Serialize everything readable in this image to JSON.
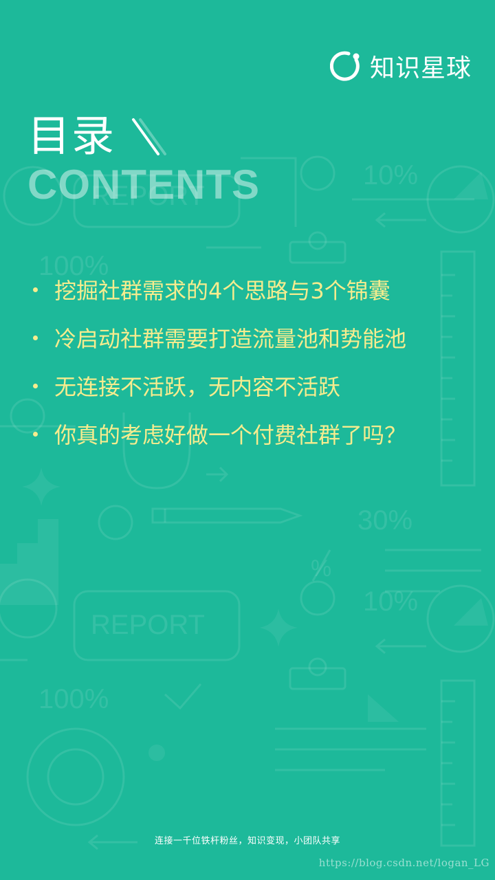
{
  "brand": {
    "name": "知识星球",
    "logo_icon": "ring-with-dot-icon"
  },
  "heading": {
    "title": "目录",
    "subtitle": "CONTENTS"
  },
  "toc": {
    "items": [
      "挖掘社群需求的4个思路与3个锦囊",
      "冷启动社群需要打造流量池和势能池",
      "无连接不活跃，无内容不活跃",
      "你真的考虑好做一个付费社群了吗？"
    ]
  },
  "background_labels": {
    "report": "REPORT",
    "pct_10": "10%",
    "pct_100": "100%",
    "pct_30": "30%",
    "percent_sign": "%"
  },
  "footer": {
    "tagline": "连接一千位铁杆粉丝，知识变现，小团队共享",
    "watermark": "https://blog.csdn.net/logan_LG"
  },
  "colors": {
    "background": "#1db99a",
    "item_text": "#f6ec8e",
    "brand_text": "#ffffff"
  }
}
